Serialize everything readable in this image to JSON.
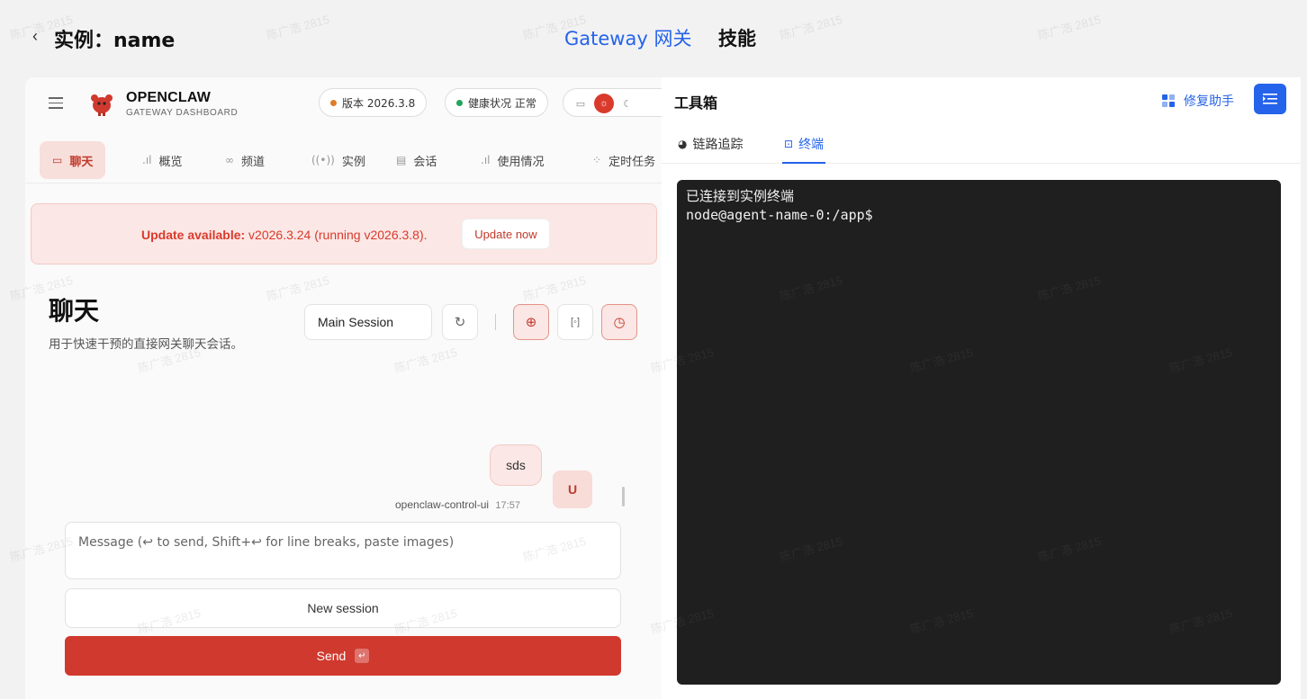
{
  "header": {
    "back_icon": "chevron-left-icon",
    "title": "实例：name",
    "tabs": [
      {
        "label": "Gateway 网关",
        "active": true
      },
      {
        "label": "技能",
        "active": false
      }
    ]
  },
  "dashboard": {
    "brand_name": "OPENCLAW",
    "brand_sub": "GATEWAY DASHBOARD",
    "version_pill": "版本 2026.3.8",
    "health_pill": "健康状况 正常",
    "version_dot_color": "#e07b2a",
    "health_dot_color": "#22a55a",
    "nav_tabs": [
      {
        "label": "聊天",
        "icon": "message-icon",
        "active": true
      },
      {
        "label": "概览",
        "icon": "bar-chart-icon",
        "active": false
      },
      {
        "label": "频道",
        "icon": "link-icon",
        "active": false
      },
      {
        "label": "实例",
        "icon": "broadcast-icon",
        "active": false
      },
      {
        "label": "会话",
        "icon": "document-icon",
        "active": false
      },
      {
        "label": "使用情况",
        "icon": "bar-chart-icon",
        "active": false
      },
      {
        "label": "定时任务",
        "icon": "loader-icon",
        "active": false
      }
    ],
    "update_banner": {
      "bold": "Update available:",
      "text": " v2026.3.24 (running v2026.3.8).",
      "button": "Update now"
    },
    "chat": {
      "title": "聊天",
      "subtitle": "用于快速干预的直接网关聊天会话。",
      "session_select": "Main Session",
      "message": {
        "text": "sds",
        "sender": "openclaw-control-ui",
        "time": "17:57",
        "avatar": "U"
      },
      "composer_placeholder": "Message (↩ to send, Shift+↩ for line breaks, paste images)",
      "new_session": "New session",
      "send": "Send"
    }
  },
  "toolbox": {
    "title": "工具箱",
    "repair_label": "修复助手",
    "tabs": [
      {
        "label": "链路追踪",
        "icon": "trace-icon",
        "active": false
      },
      {
        "label": "终端",
        "icon": "terminal-icon",
        "active": true
      }
    ],
    "terminal_lines": [
      "已连接到实例终端",
      "node@agent-name-0:/app$"
    ]
  },
  "watermark": "陈广浩 2815",
  "colors": {
    "accent_blue": "#2563eb",
    "brand_red": "#d0392e"
  }
}
